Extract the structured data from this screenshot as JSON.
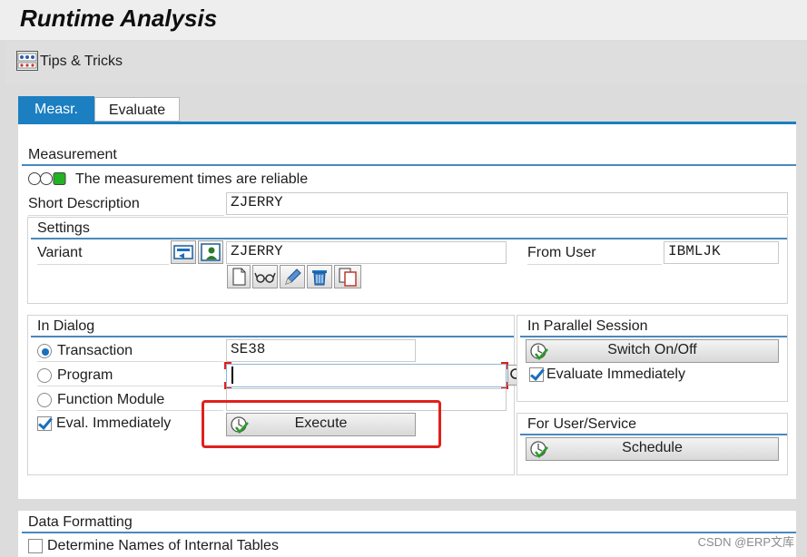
{
  "title": "Runtime Analysis",
  "toolbar": {
    "tips_label": "Tips & Tricks",
    "tips_icon": "tips-icon"
  },
  "tabs": [
    {
      "label": "Measr.",
      "active": true
    },
    {
      "label": "Evaluate",
      "active": false
    }
  ],
  "measurement": {
    "title": "Measurement",
    "status_text": "The measurement times are reliable",
    "short_description_label": "Short Description",
    "short_description_value": "ZJERRY",
    "settings": {
      "title": "Settings",
      "variant_label": "Variant",
      "variant_value": "ZJERRY",
      "from_user_label": "From User",
      "from_user_value": "IBMLJK"
    }
  },
  "in_dialog": {
    "title": "In Dialog",
    "transaction_label": "Transaction",
    "transaction_value": "SE38",
    "program_label": "Program",
    "program_value": "",
    "function_module_label": "Function Module",
    "function_module_value": "",
    "eval_immediately_label": "Eval. Immediately",
    "execute_label": "Execute"
  },
  "parallel": {
    "title": "In Parallel Session",
    "switch_label": "Switch On/Off",
    "evaluate_immediately_label": "Evaluate Immediately"
  },
  "user_service": {
    "title": "For User/Service",
    "schedule_label": "Schedule"
  },
  "data_formatting": {
    "title": "Data Formatting",
    "determine_names_label": "Determine Names of Internal Tables"
  },
  "watermark": "CSDN @ERP文库",
  "colors": {
    "accent": "#1b7fc1",
    "highlight_red": "#e0201c",
    "status_green": "#20b020"
  }
}
